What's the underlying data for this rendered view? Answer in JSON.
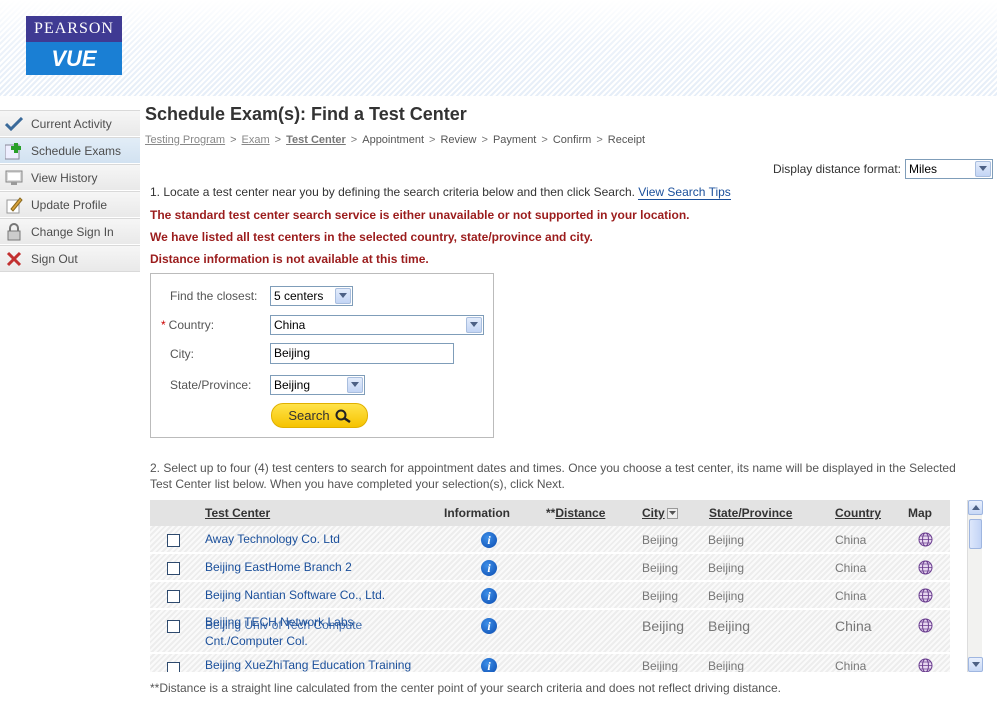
{
  "logo": {
    "top": "PEARSON",
    "bottom": "VUE"
  },
  "sidebar": {
    "items": [
      {
        "label": "Current Activity",
        "icon": "check-icon"
      },
      {
        "label": "Schedule Exams",
        "icon": "plus-icon"
      },
      {
        "label": "View History",
        "icon": "history-icon"
      },
      {
        "label": "Update Profile",
        "icon": "pencil-icon"
      },
      {
        "label": "Change Sign In",
        "icon": "lock-icon"
      },
      {
        "label": "Sign Out",
        "icon": "x-icon"
      }
    ]
  },
  "page": {
    "title": "Schedule Exam(s): Find a Test Center",
    "breadcrumb": [
      "Testing Program",
      "Exam",
      "Test Center",
      "Appointment",
      "Review",
      "Payment",
      "Confirm",
      "Receipt"
    ]
  },
  "distance": {
    "label": "Display distance format:",
    "value": "Miles"
  },
  "step1": {
    "text": "1. Locate a test center near you by defining the search criteria below and then click Search.",
    "link": "View Search Tips"
  },
  "messages": [
    "The standard test center search service is either unavailable or not supported in your location.",
    "We have listed all test centers in the selected country, state/province and city.",
    "Distance information is not available at this time."
  ],
  "form": {
    "closest_label": "Find the closest:",
    "closest_value": "5 centers",
    "country_req": "*",
    "country_label": "Country:",
    "country_value": "China",
    "city_label": "City:",
    "city_value": "Beijing",
    "state_label": "State/Province:",
    "state_value": "Beijing",
    "search_label": "Search"
  },
  "step2": {
    "text": "2. Select up to four (4) test centers to search for appointment dates and times. Once you choose a test center, its name will be displayed in the Selected Test Center list below. When you have completed your selection(s), click Next."
  },
  "table": {
    "headers": {
      "center": "Test Center",
      "info": "Information",
      "distance_prefix": "**",
      "distance": "Distance",
      "city": "City",
      "state": "State/Province",
      "country": "Country",
      "map": "Map"
    },
    "rows": [
      {
        "name": "Away Technology Co. Ltd",
        "city": "Beijing",
        "state": "Beijing",
        "country": "China"
      },
      {
        "name": "Beijing EastHome Branch 2",
        "city": "Beijing",
        "state": "Beijing",
        "country": "China"
      },
      {
        "name": "Beijing Nantian Software Co., Ltd.",
        "city": "Beijing",
        "state": "Beijing",
        "country": "China"
      },
      {
        "name": "Beijing TECH Network Labs",
        "name_overlap": "Beijing Univ of Tech Compute",
        "name2": "Cnt./Computer Col.",
        "city": "Beijing",
        "state": "Beijing",
        "country": "China"
      },
      {
        "name": "Beijing XueZhiTang Education Training",
        "city": "Beijing",
        "state": "Beijing",
        "country": "China"
      }
    ]
  },
  "footnote": "**Distance is a straight line calculated from the center point of your search criteria and does not reflect driving distance.",
  "colors": {
    "link": "#1a4f9b",
    "error": "#9b1c1c",
    "accent_yellow": "#f6c300"
  }
}
